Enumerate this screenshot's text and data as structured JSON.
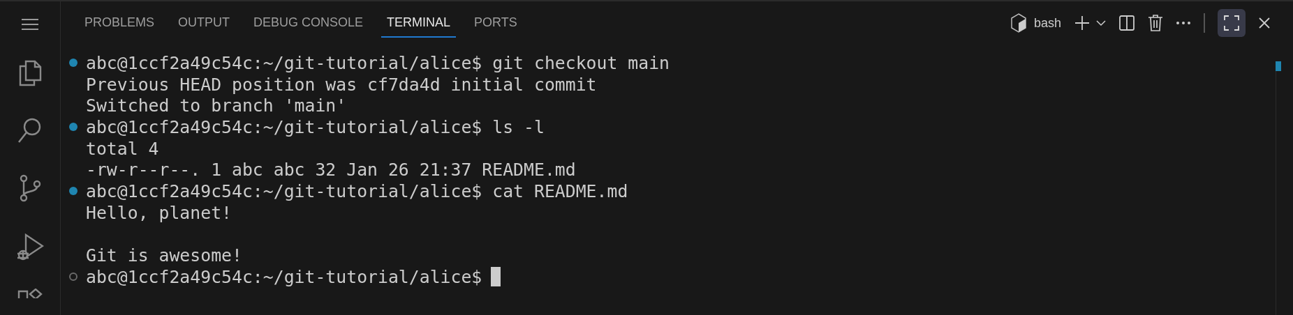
{
  "tabs": [
    {
      "label": "PROBLEMS",
      "selected": false
    },
    {
      "label": "OUTPUT",
      "selected": false
    },
    {
      "label": "DEBUG CONSOLE",
      "selected": false
    },
    {
      "label": "TERMINAL",
      "selected": true
    },
    {
      "label": "PORTS",
      "selected": false
    }
  ],
  "terminal_toolbar": {
    "shell": "bash",
    "maximized": true
  },
  "terminal": {
    "lines": [
      {
        "kind": "prompt",
        "finished": true,
        "text": "abc@1ccf2a49c54c:~/git-tutorial/alice$ git checkout main"
      },
      {
        "kind": "output",
        "text": "Previous HEAD position was cf7da4d initial commit"
      },
      {
        "kind": "output",
        "text": "Switched to branch 'main'"
      },
      {
        "kind": "prompt",
        "finished": true,
        "text": "abc@1ccf2a49c54c:~/git-tutorial/alice$ ls -l"
      },
      {
        "kind": "output",
        "text": "total 4"
      },
      {
        "kind": "output",
        "text": "-rw-r--r--. 1 abc abc 32 Jan 26 21:37 README.md"
      },
      {
        "kind": "prompt",
        "finished": true,
        "text": "abc@1ccf2a49c54c:~/git-tutorial/alice$ cat README.md"
      },
      {
        "kind": "output",
        "text": "Hello, planet!"
      },
      {
        "kind": "blank"
      },
      {
        "kind": "output",
        "text": "Git is awesome!"
      },
      {
        "kind": "prompt",
        "finished": false,
        "text": "abc@1ccf2a49c54c:~/git-tutorial/alice$",
        "cursor": true
      }
    ]
  }
}
